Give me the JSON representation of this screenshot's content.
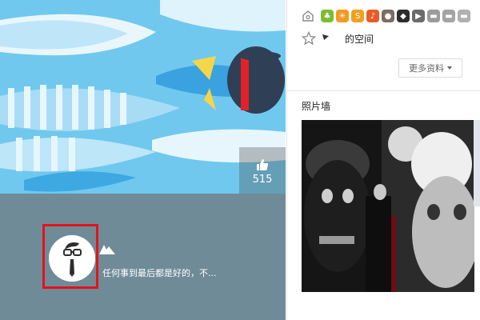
{
  "banner": {
    "like_count": "515"
  },
  "profile": {
    "signature": "任何事到最后都是好的，不..."
  },
  "right_panel": {
    "space_title": "的空间",
    "more_info_label": "更多资料",
    "photo_wall_title": "照片墙",
    "badges": [
      {
        "name": "fruit-badge-icon",
        "color": "#7cbd32",
        "glyph": "♣"
      },
      {
        "name": "sun-badge-icon",
        "color": "#f39a1e",
        "glyph": "☀"
      },
      {
        "name": "s-badge-icon",
        "color": "#f0a020",
        "glyph": "S"
      },
      {
        "name": "music-badge-icon",
        "color": "#e85c23",
        "glyph": "♪"
      },
      {
        "name": "game-badge-icon",
        "color": "#7d6c62",
        "glyph": "●"
      },
      {
        "name": "penguin-badge-icon",
        "color": "#2c2c2c",
        "glyph": "◆"
      },
      {
        "name": "video-badge-icon",
        "color": "#6b6b6b",
        "glyph": "▶"
      },
      {
        "name": "card-badge-icon",
        "color": "#9b9b9b",
        "glyph": "▬"
      },
      {
        "name": "card2-badge-icon",
        "color": "#a4a4a4",
        "glyph": "▬"
      },
      {
        "name": "card3-badge-icon",
        "color": "#b0b0b0",
        "glyph": "▬"
      }
    ]
  }
}
